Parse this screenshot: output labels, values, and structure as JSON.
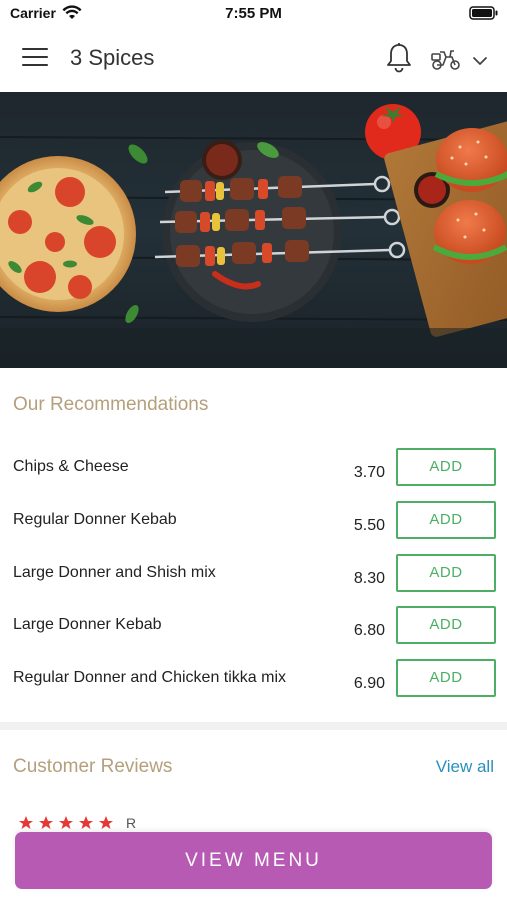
{
  "status_bar": {
    "carrier": "Carrier",
    "time": "7:55 PM"
  },
  "header": {
    "title": "3 Spices"
  },
  "recommendations": {
    "title": "Our Recommendations",
    "items": [
      {
        "name": "Chips & Cheese",
        "price": "3.70",
        "button": "ADD"
      },
      {
        "name": "Regular Donner Kebab",
        "price": "5.50",
        "button": "ADD"
      },
      {
        "name": "Large Donner and Shish mix",
        "price": "8.30",
        "button": "ADD"
      },
      {
        "name": "Large Donner Kebab",
        "price": "6.80",
        "button": "ADD"
      },
      {
        "name": "Regular Donner and Chicken tikka mix",
        "price": "6.90",
        "button": "ADD"
      }
    ]
  },
  "reviews": {
    "title": "Customer Reviews",
    "view_all": "View all",
    "reviewer_initial": "R"
  },
  "bottom": {
    "view_menu": "VIEW MENU"
  },
  "colors": {
    "accent_purple": "#b75ab4",
    "add_green": "#4caf65",
    "section_title": "#b59f7c",
    "link_blue": "#2a8fbd",
    "star_red": "#e53935"
  },
  "icons": [
    "wifi-icon",
    "battery-icon",
    "menu-icon",
    "bell-icon",
    "delivery-scooter-icon",
    "chevron-down-icon",
    "star-icon"
  ]
}
